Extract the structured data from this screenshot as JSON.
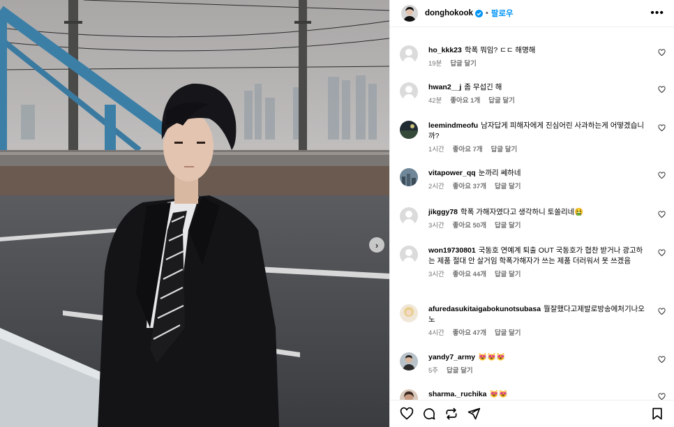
{
  "post": {
    "username": "donghokook",
    "follow_label": "팔로우",
    "separator": "•",
    "more_label": "•••"
  },
  "carousel": {
    "next_label": "›"
  },
  "comments": [
    {
      "user": "ho_kkk23",
      "text": "학폭 뭐임? ㄷㄷ 해명해",
      "time": "19분",
      "likes": "",
      "reply": "답글 달기"
    },
    {
      "user": "hwan2__j",
      "text": "좀 무섭긴 해",
      "time": "42분",
      "likes": "좋아요 1개",
      "reply": "답글 달기"
    },
    {
      "user": "leemindmeofu",
      "text": "남자답게 피해자에게 진심어린 사과하는게 어떻겠습니까?",
      "time": "1시간",
      "likes": "좋아요 7개",
      "reply": "답글 달기"
    },
    {
      "user": "vitapower_qq",
      "text": "눈까리 쎄하네",
      "time": "2시간",
      "likes": "좋아요 37개",
      "reply": "답글 달기"
    },
    {
      "user": "jikggy78",
      "text": "학폭 가해자였다고 생각하니 토쏠리네🤮",
      "time": "3시간",
      "likes": "좋아요 50개",
      "reply": "답글 달기"
    },
    {
      "user": "won19730801",
      "text": "국동호 연예계 퇴출 OUT 국동호가 협찬 받거나 광고하는 제품 절대 안 살거임 학폭가해자가 쓰는 제품 더러워서 못 쓰겠음",
      "time": "3시간",
      "likes": "좋아요 44개",
      "reply": "답글 달기"
    },
    {
      "user": "afuredasukitaigabokunotsubasa",
      "text": "뭘잘했다고제발로방송에처기나오노",
      "time": "4시간",
      "likes": "좋아요 47개",
      "reply": "답글 달기"
    },
    {
      "user": "yandy7_army",
      "text": "😻😻😻",
      "time": "5주",
      "likes": "",
      "reply": "답글 달기"
    },
    {
      "user": "sharma._ruchika",
      "text": "😻😻",
      "time": "",
      "likes": "",
      "reply": ""
    }
  ],
  "colors": {
    "accent": "#0095f6",
    "meta": "#737373",
    "divider": "#efefef"
  }
}
